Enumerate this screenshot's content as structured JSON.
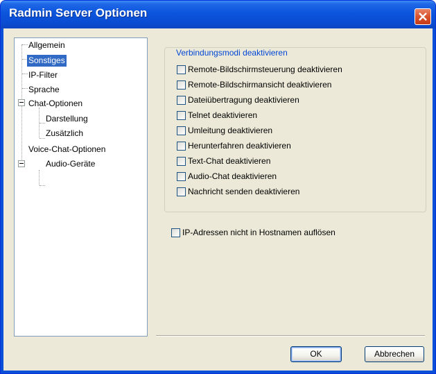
{
  "window": {
    "title": "Radmin Server Optionen"
  },
  "tree": {
    "items": [
      {
        "label": "Allgemein",
        "selected": false
      },
      {
        "label": "Sonstiges",
        "selected": true
      },
      {
        "label": "IP-Filter",
        "selected": false
      },
      {
        "label": "Sprache",
        "selected": false
      },
      {
        "label": "Chat-Optionen",
        "selected": false,
        "expanded": true
      },
      {
        "label": "Darstellung",
        "selected": false
      },
      {
        "label": "Zusätzlich",
        "selected": false
      },
      {
        "label": "Voice-Chat-Optionen",
        "selected": false,
        "expanded": true
      },
      {
        "label": "Audio-Geräte",
        "selected": false
      }
    ]
  },
  "group": {
    "title": "Verbindungsmodi deaktivieren",
    "checkboxes": [
      {
        "label": "Remote-Bildschirmsteuerung deaktivieren",
        "checked": false
      },
      {
        "label": "Remote-Bildschirmansicht deaktivieren",
        "checked": false
      },
      {
        "label": "Dateiübertragung deaktivieren",
        "checked": false
      },
      {
        "label": "Telnet deaktivieren",
        "checked": false
      },
      {
        "label": "Umleitung deaktivieren",
        "checked": false
      },
      {
        "label": "Herunterfahren deaktivieren",
        "checked": false
      },
      {
        "label": "Text-Chat deaktivieren",
        "checked": false
      },
      {
        "label": "Audio-Chat deaktivieren",
        "checked": false
      },
      {
        "label": "Nachricht senden deaktivieren",
        "checked": false
      }
    ]
  },
  "ip_option": {
    "label": "IP-Adressen nicht in Hostnamen auflösen",
    "checked": false
  },
  "buttons": {
    "ok": "OK",
    "cancel": "Abbrechen"
  }
}
